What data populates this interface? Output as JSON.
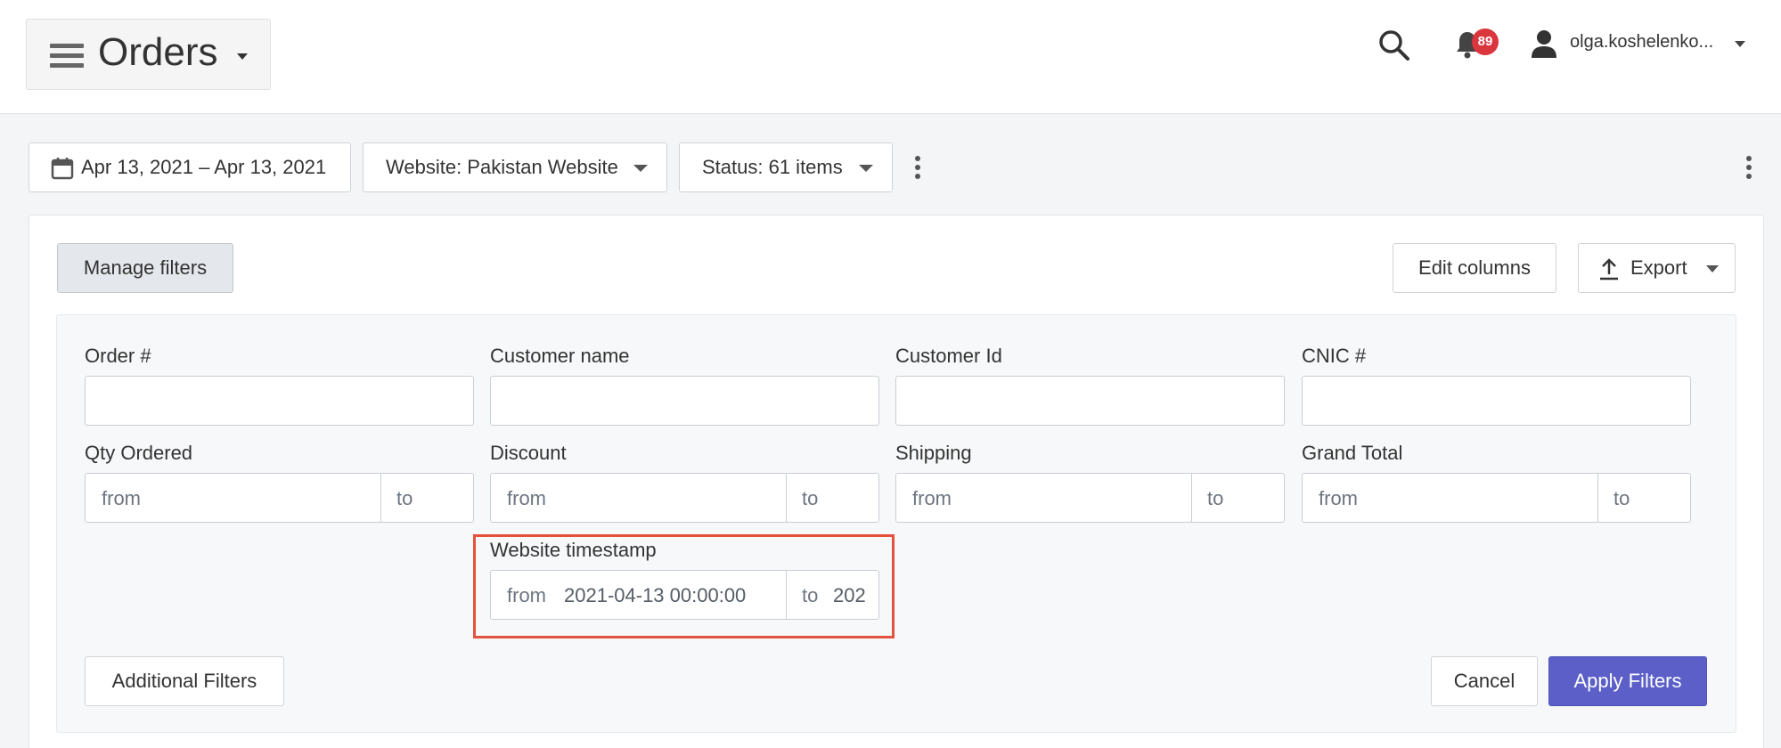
{
  "header": {
    "title": "Orders",
    "notifications_count": "89",
    "user_name": "olga.koshelenko..."
  },
  "toolbar": {
    "date_range": "Apr 13, 2021 – Apr 13, 2021",
    "website_filter": "Website: Pakistan Website",
    "status_filter": "Status: 61 items"
  },
  "actions": {
    "manage_filters": "Manage filters",
    "edit_columns": "Edit columns",
    "export": "Export"
  },
  "filters": {
    "order_no": {
      "label": "Order #",
      "value": ""
    },
    "customer_name": {
      "label": "Customer name",
      "value": ""
    },
    "customer_id": {
      "label": "Customer Id",
      "value": ""
    },
    "cnic": {
      "label": "CNIC #",
      "value": ""
    },
    "qty_ordered": {
      "label": "Qty Ordered",
      "from": "from",
      "to": "to"
    },
    "discount": {
      "label": "Discount",
      "from": "from",
      "to": "to"
    },
    "shipping": {
      "label": "Shipping",
      "from": "from",
      "to": "to"
    },
    "grand_total": {
      "label": "Grand Total",
      "from": "from",
      "to": "to"
    },
    "website_timestamp": {
      "label": "Website timestamp",
      "from": "from",
      "from_value": "2021-04-13 00:00:00",
      "to": "to",
      "to_value": "202"
    }
  },
  "footer": {
    "additional_filters": "Additional Filters",
    "cancel": "Cancel",
    "apply": "Apply Filters"
  },
  "colors": {
    "accent": "#5b5fc7",
    "badge": "#d9363e",
    "highlight": "#e4513c"
  }
}
